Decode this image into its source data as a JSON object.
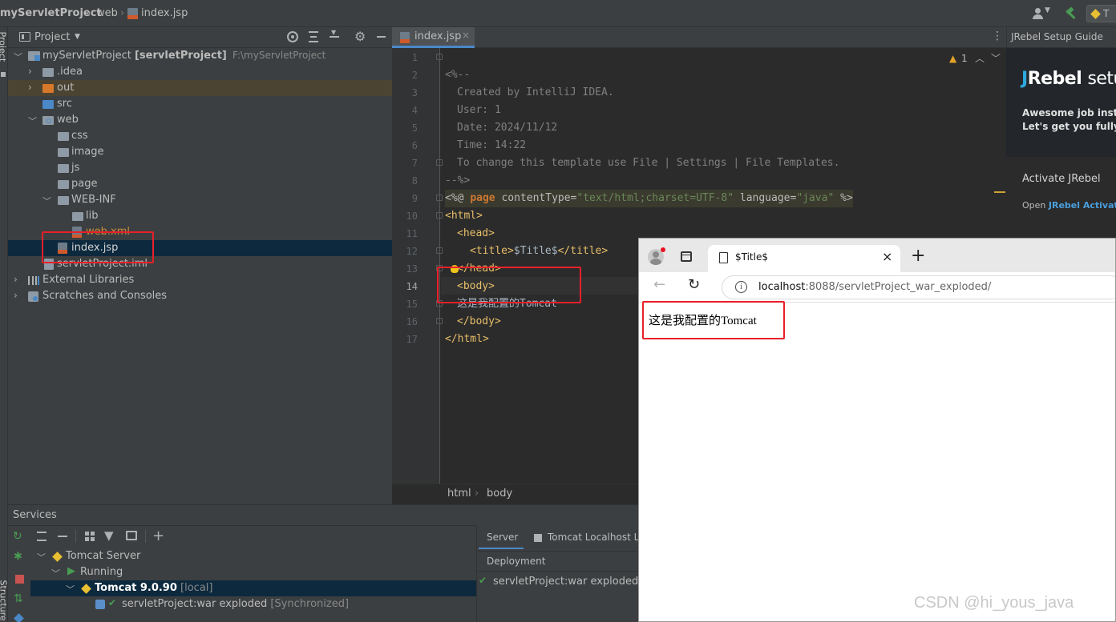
{
  "breadcrumb": {
    "project": "myServletProject",
    "folder": "web",
    "file": "index.jsp"
  },
  "toolbar": {
    "run_config": "T"
  },
  "stripe": {
    "project": "Project",
    "structure": "Structure"
  },
  "project_panel": {
    "title": "Project",
    "root": {
      "name": "myServletProject",
      "module": "[servletProject]",
      "path": "F:\\myServletProject"
    },
    "items": [
      {
        "label": "idea",
        "prefix": "."
      },
      {
        "label": "out"
      },
      {
        "label": "src"
      },
      {
        "label": "web"
      },
      {
        "label": "css"
      },
      {
        "label": "image"
      },
      {
        "label": "js"
      },
      {
        "label": "page"
      },
      {
        "label": "WEB-INF"
      },
      {
        "label": "lib"
      },
      {
        "label": "web.xml"
      },
      {
        "label": "index.jsp"
      },
      {
        "label": "servletProject.iml"
      },
      {
        "label": "External Libraries"
      },
      {
        "label": "Scratches and Consoles"
      }
    ]
  },
  "editor": {
    "tab": "index.jsp",
    "warnings": "1",
    "current_line": "14",
    "lines": [
      "1",
      "2",
      "3",
      "4",
      "5",
      "6",
      "7",
      "8",
      "9",
      "10",
      "11",
      "12",
      "13",
      "14",
      "15",
      "16",
      "17"
    ],
    "code": {
      "l1": "<%--",
      "l2": "Created by IntelliJ IDEA.",
      "l3": "User: 1",
      "l4": "Date: 2024/11/12",
      "l5": "Time: 14:22",
      "l6": "To change this template use File | Settings | File Templates.",
      "l7": "--%>",
      "l8_open": "<%@",
      "l8_kw": "page",
      "l8_a1": "contentType=",
      "l8_v1": "\"text/html;charset=UTF-8\"",
      "l8_a2": "language=",
      "l8_v2": "\"java\"",
      "l8_close": "%>",
      "l9": "<html>",
      "l10": "<head>",
      "l11_open": "<title>",
      "l11_text": "$Title$",
      "l11_close": "</title>",
      "l12": "</head>",
      "l13": "<body>",
      "l14": "这是我配置的Tomcat",
      "l15": "</body>",
      "l16": "</html>"
    },
    "breadcrumb": [
      "html",
      "body"
    ]
  },
  "jrebel": {
    "header": "JRebel Setup Guide",
    "logo_j": "J",
    "logo_rest": "Rebel",
    "logo_tail": "setu",
    "desc1": "Awesome job insta",
    "desc2": "Let's get you fully s",
    "activate": "Activate JRebel",
    "open_prefix": "Open",
    "open_link": "JRebel Activatio"
  },
  "services": {
    "title": "Services",
    "tree": {
      "server": "Tomcat Server",
      "running": "Running",
      "tomcat": "Tomcat 9.0.90",
      "tomcat_tag": "[local]",
      "artifact": "servletProject:war exploded",
      "artifact_tag": "[Synchronized]"
    },
    "tabs": {
      "server": "Server",
      "log": "Tomcat Localhost Log"
    },
    "deployment": {
      "header": "Deployment",
      "item": "servletProject:war exploded"
    }
  },
  "browser": {
    "tab_title": "$Title$",
    "url_host": "localhost",
    "url_rest": ":8088/servletProject_war_exploded/",
    "content": "这是我配置的Tomcat"
  },
  "watermark": "CSDN @hi_yous_java",
  "colors": {
    "ide_bg": "#2b2b2b",
    "panel_bg": "#3c3f41",
    "selected_row": "#0d293e",
    "highlight_red": "#e8202a",
    "tag_color": "#e8bf6a",
    "string_green": "#6a8759",
    "keyword_orange": "#cc7832",
    "comment_gray": "#808080",
    "jrebel_bg": "#23272c"
  }
}
